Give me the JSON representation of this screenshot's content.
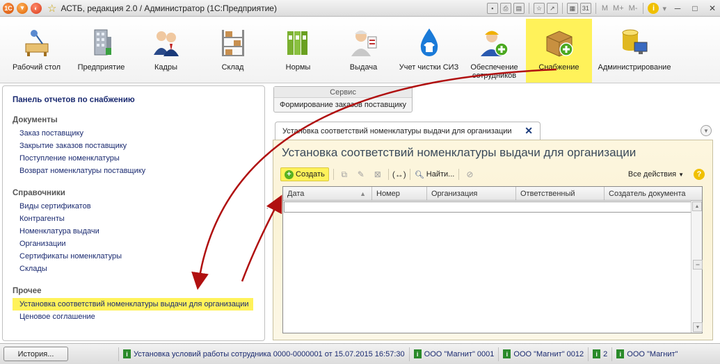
{
  "window": {
    "title": "АСТБ, редакция 2.0 / Администратор  (1С:Предприятие)",
    "mplus": [
      "M",
      "M+",
      "M-"
    ]
  },
  "sections": [
    {
      "label": "Рабочий стол",
      "icon": "desk-lamp-icon"
    },
    {
      "label": "Предприятие",
      "icon": "building-icon"
    },
    {
      "label": "Кадры",
      "icon": "people-icon"
    },
    {
      "label": "Склад",
      "icon": "shelves-icon"
    },
    {
      "label": "Нормы",
      "icon": "binders-icon"
    },
    {
      "label": "Выдача",
      "icon": "worker-clipboard-icon"
    },
    {
      "label": "Учет чистки СИЗ",
      "icon": "water-drop-icon"
    },
    {
      "label": "Обеспечение сотрудников",
      "icon": "worker-add-icon"
    },
    {
      "label": "Снабжение",
      "icon": "box-add-icon"
    },
    {
      "label": "Администрирование",
      "icon": "database-computer-icon"
    }
  ],
  "left_panel": {
    "title": "Панель отчетов по снабжению",
    "groups": [
      {
        "title": "Документы",
        "items": [
          "Заказ поставщику",
          "Закрытие заказов поставщику",
          "Поступление номенклатуры",
          "Возврат номенклатуры поставщику"
        ]
      },
      {
        "title": "Справочники",
        "items": [
          "Виды сертификатов",
          "Контрагенты",
          "Номенклатура выдачи",
          "Организации",
          "Сертификаты номенклатуры",
          "Склады"
        ]
      },
      {
        "title": "Прочее",
        "items": [
          "Установка соответствий номенклатуры выдачи для организации",
          "Ценовое соглашение"
        ]
      }
    ]
  },
  "service": {
    "header": "Сервис",
    "item": "Формирование заказов поставщику"
  },
  "tab": {
    "label": "Установка соответствий номенклатуры выдачи для организации"
  },
  "form": {
    "title": "Установка соответствий номенклатуры выдачи для организации",
    "create_label": "Создать",
    "find_label": "Найти...",
    "all_actions_label": "Все действия",
    "columns": [
      "Дата",
      "Номер",
      "Организация",
      "Ответственный",
      "Создатель документа"
    ]
  },
  "statusbar": {
    "history_label": "История...",
    "messages": [
      "Установка условий работы сотрудника 0000-0000001 от 15.07.2015 16:57:30",
      "ООО \"Магнит\" 0001",
      "ООО \"Магнит\" 0012",
      "2",
      "ООО \"Магнит\""
    ]
  },
  "colors": {
    "highlight": "#fff25a",
    "link": "#1a2a70",
    "arrow": "#b01010"
  }
}
